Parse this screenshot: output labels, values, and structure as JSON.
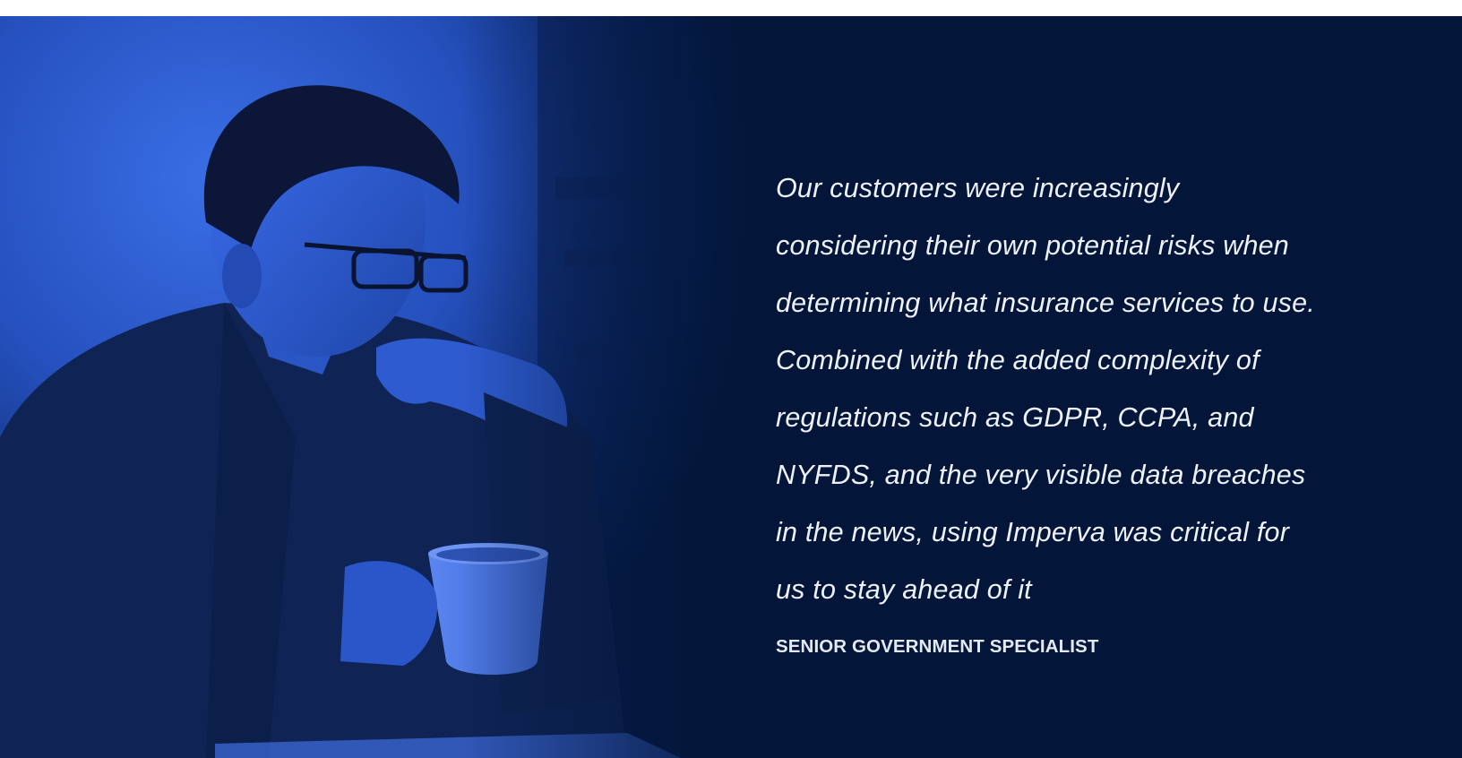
{
  "testimonial": {
    "quote_lines": [
      "Our customers were increasingly",
      "considering their own potential risks when",
      "determining what insurance services to use.",
      "Combined with the added complexity of",
      "regulations such as GDPR, CCPA, and",
      "NYFDS, and the very visible data breaches",
      "in the news, using Imperva was critical for",
      "us to stay ahead of it"
    ],
    "attribution": "SENIOR GOVERNMENT SPECIALIST"
  },
  "colors": {
    "banner_background": "#031639",
    "photo_tint": "#2d5fd6",
    "quote_text": "#eef1f7"
  },
  "images": {
    "photo_icon": "person-with-coffee-mug-photo"
  }
}
